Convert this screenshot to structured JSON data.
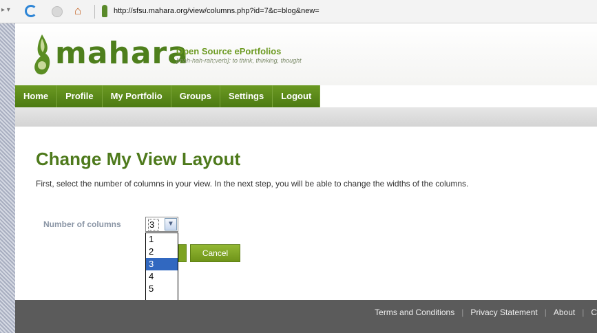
{
  "browser": {
    "url": "http://sfsu.mahara.org/view/columns.php?id=7&c=blog&new="
  },
  "site": {
    "logo_text": "mahara",
    "tagline_title": "Open Source ePortfolios",
    "tagline_sub": "[mah-hah-rah;verb]: to think, thinking, thought"
  },
  "nav": {
    "items": [
      {
        "label": "Home"
      },
      {
        "label": "Profile"
      },
      {
        "label": "My Portfolio"
      },
      {
        "label": "Groups"
      },
      {
        "label": "Settings"
      },
      {
        "label": "Logout"
      }
    ]
  },
  "main": {
    "title": "Change My View Layout",
    "intro": "First, select the number of columns in your view. In the next step, you will be able to change the widths of the columns.",
    "columns_label": "Number of columns",
    "columns_selected": "3",
    "columns_options": [
      "1",
      "2",
      "3",
      "4",
      "5"
    ],
    "cancel_label": "Cancel"
  },
  "footer": {
    "links": [
      "Terms and Conditions",
      "Privacy Statement",
      "About",
      "C"
    ]
  },
  "colors": {
    "brand_green": "#4e7f1c",
    "nav_green": "#5a8a1a",
    "selected_option": "#3168c0",
    "footer_bg": "#5b5b5b"
  }
}
